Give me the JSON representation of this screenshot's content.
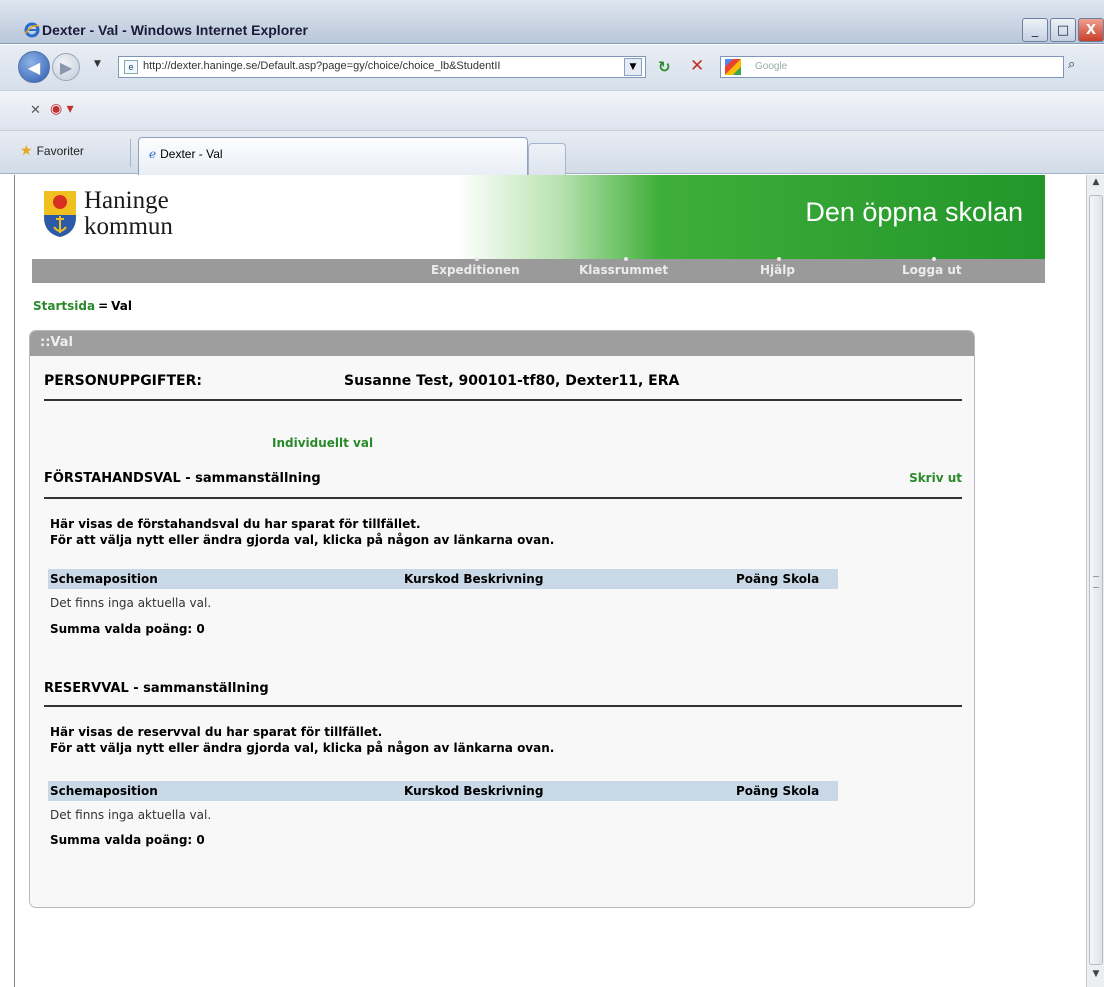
{
  "window": {
    "title": "Dexter - Val - Windows Internet Explorer",
    "minimize": "_",
    "maximize": "□",
    "close": "X"
  },
  "address": {
    "url": "http://dexter.haninge.se/Default.asp?page=gy/choice/choice_lb&StudentII",
    "search_placeholder": "Google"
  },
  "favorites": {
    "label": "Favoriter",
    "tab_title": "Dexter - Val"
  },
  "site": {
    "logo_line1": "Haninge",
    "logo_line2": "kommun",
    "slogan": "Den öppna skolan",
    "nav": [
      "Expeditionen",
      "Klassrummet",
      "Hjälp",
      "Logga ut"
    ]
  },
  "breadcrumb": {
    "home": "Startsida",
    "separator": "=",
    "current": "Val"
  },
  "panel": {
    "header": "::Val",
    "personal_label": "PERSONUPPGIFTER:",
    "personal_value": "Susanne Test, 900101-tf80, Dexter11, ERA",
    "individual_link": "Individuellt val",
    "print_link": "Skriv ut"
  },
  "sections": [
    {
      "title": "FÖRSTAHANDSVAL - sammanställning",
      "info_line1": "Här visas de förstahandsval du har sparat för tillfället.",
      "info_line2": "För att välja nytt eller ändra gjorda val, klicka på någon av länkarna ovan.",
      "columns": [
        "Schemaposition",
        "Kurskod Beskrivning",
        "Poäng Skola"
      ],
      "empty_text": "Det finns inga aktuella val.",
      "sum_text": "Summa valda poäng: 0"
    },
    {
      "title": "RESERVVAL - sammanställning",
      "info_line1": "Här visas de reservval du har sparat för tillfället.",
      "info_line2": "För att välja nytt eller ändra gjorda val, klicka på någon av länkarna ovan.",
      "columns": [
        "Schemaposition",
        "Kurskod Beskrivning",
        "Poäng Skola"
      ],
      "empty_text": "Det finns inga aktuella val.",
      "sum_text": "Summa valda poäng: 0"
    }
  ],
  "colors": {
    "brand_green": "#22962a",
    "link_green": "#2a8a2a",
    "nav_gray": "#9a9a9a"
  }
}
